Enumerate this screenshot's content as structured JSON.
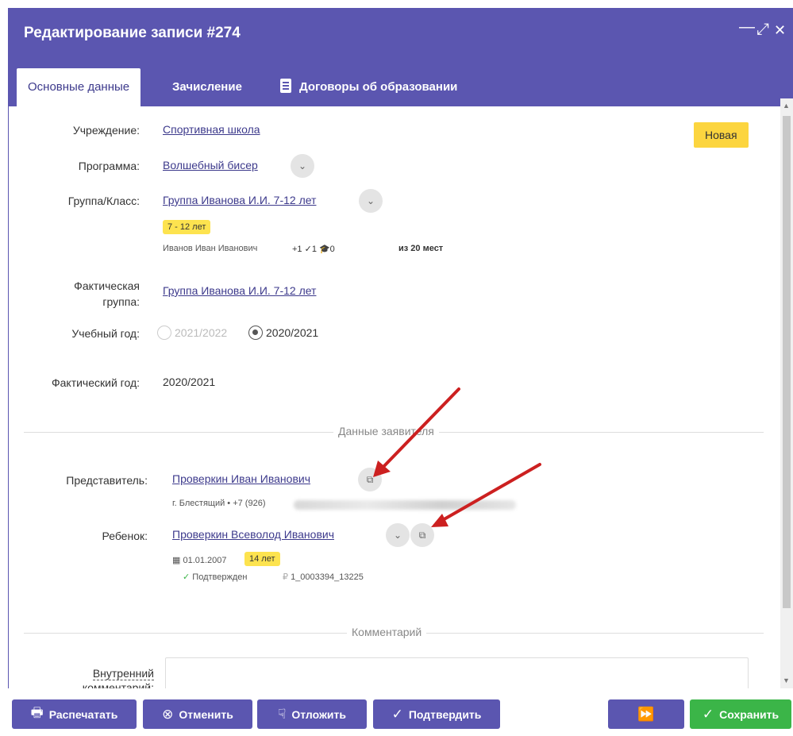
{
  "dialog": {
    "title": "Редактирование записи #274",
    "minimize": "—",
    "maximize": "⤢",
    "close": "✕"
  },
  "tabs": [
    {
      "label": "Основные данные"
    },
    {
      "label": "Зачисление"
    },
    {
      "label": "Договоры об образовании"
    }
  ],
  "status": "Новая",
  "fields": {
    "institution_label": "Учреждение:",
    "institution_value": "Спортивная школа",
    "program_label": "Программа:",
    "program_value": "Волшебный бисер",
    "group_label": "Группа/Класс:",
    "group_value": "Группа Иванова И.И. 7-12 лет",
    "group_age": "7 - 12 лет",
    "group_teacher": "Иванов Иван Иванович",
    "group_stats": "+1 ✓1 🎓0",
    "group_places": "из 20 мест",
    "actual_group_label_1": "Фактическая",
    "actual_group_label_2": "группа:",
    "actual_group_value": "Группа Иванова И.И. 7-12 лет",
    "school_year_label": "Учебный год:",
    "school_year_opt1": "2021/2022",
    "school_year_opt2": "2020/2021",
    "actual_year_label": "Фактический год:",
    "actual_year_value": "2020/2021"
  },
  "applicant_section": "Данные заявителя",
  "applicant": {
    "rep_label": "Представитель:",
    "rep_value": "Проверкин Иван Иванович",
    "rep_contact": "г. Блестящий • +7 (926)",
    "child_label": "Ребенок:",
    "child_value": "Проверкин Всеволод Иванович",
    "child_birth": "01.01.2007",
    "child_age": "14 лет",
    "child_confirmed": "Подтвержден",
    "child_account": "1_0003394_13225"
  },
  "comment_section": "Комментарий",
  "comment": {
    "internal_label_1": "Внутренний",
    "internal_label_2": "комментарий:"
  },
  "buttons": {
    "print": "Распечатать",
    "cancel": "Отменить",
    "postpone": "Отложить",
    "confirm": "Подтвердить",
    "save": "Сохранить"
  },
  "colors": {
    "accent": "#5b56b0",
    "save": "#3bb548",
    "badge": "#fcd53f",
    "arrow": "#cc2020"
  }
}
